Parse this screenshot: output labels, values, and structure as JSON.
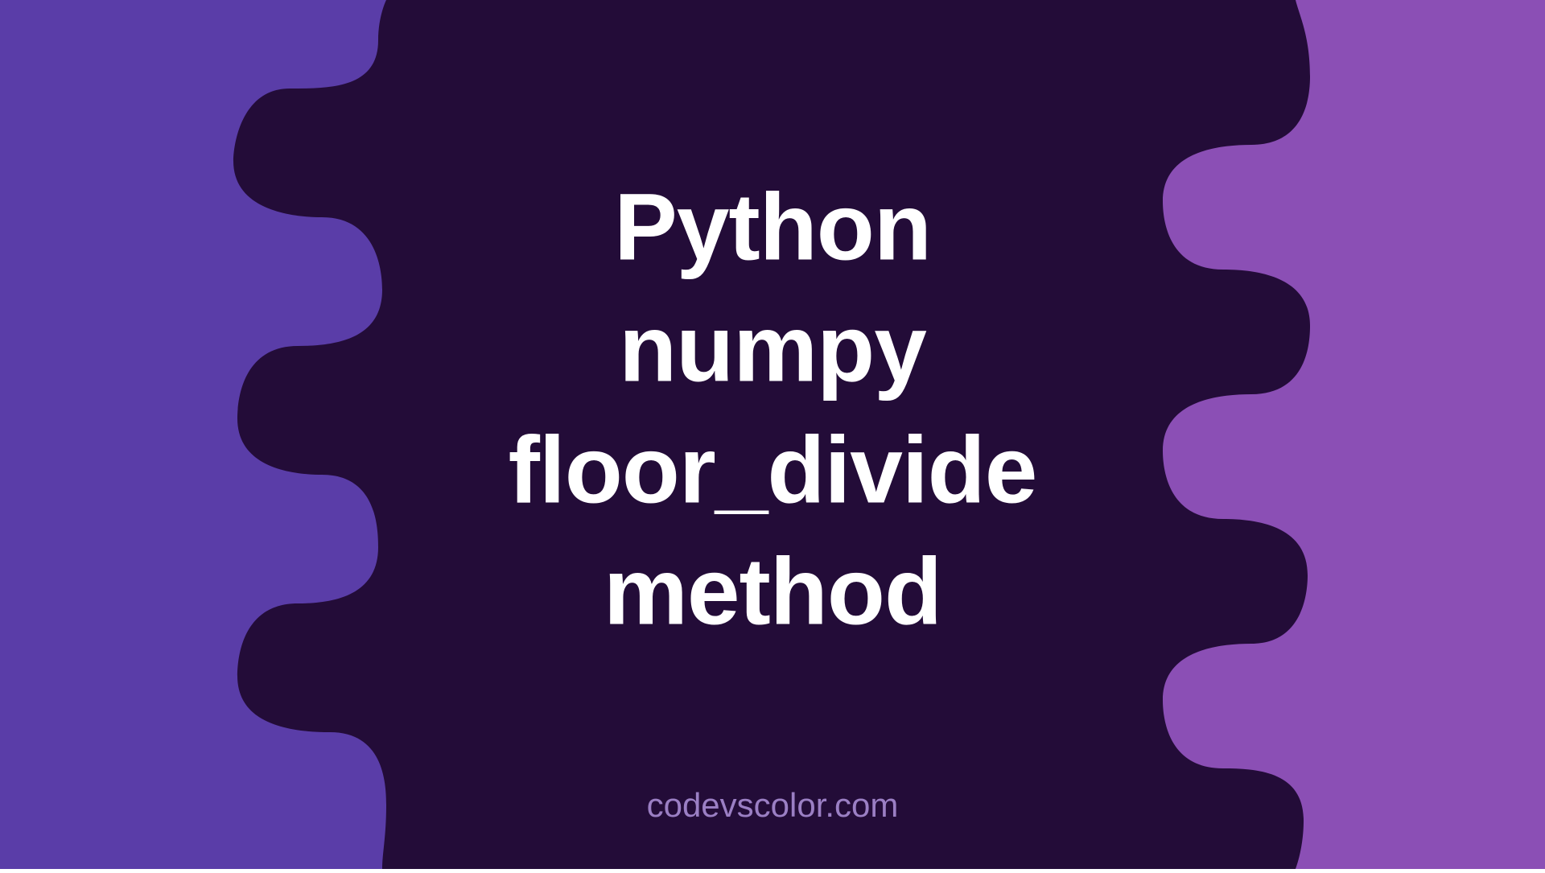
{
  "hero": {
    "line1": "Python",
    "line2": "numpy",
    "line3": "floor_divide",
    "line4": "method"
  },
  "attribution": "codevscolor.com",
  "colors": {
    "left_bg": "#5a3da8",
    "right_bg": "#8b4fb5",
    "blob": "#230c38",
    "text": "#ffffff",
    "attribution_text": "#9b7fc4"
  }
}
